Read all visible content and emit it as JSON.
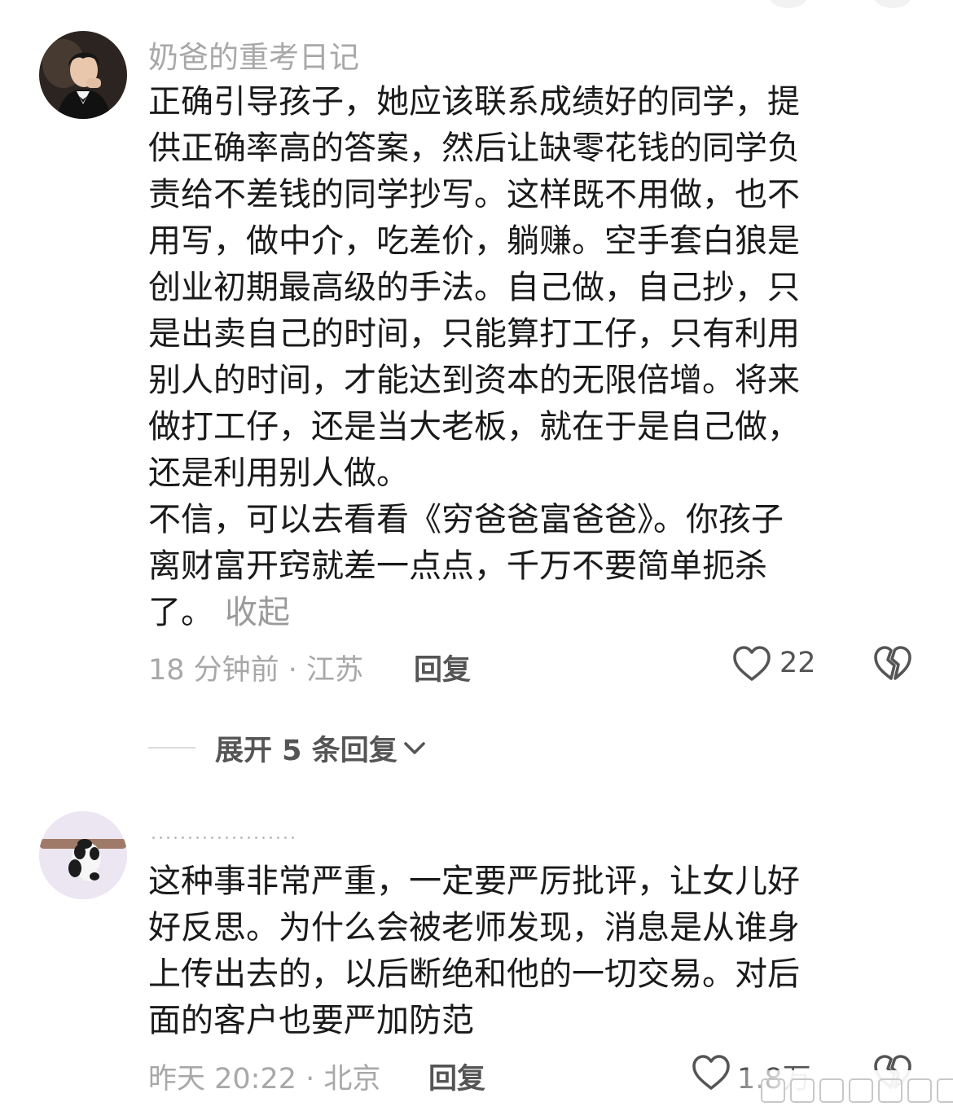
{
  "comments": [
    {
      "username": "奶爸的重考日记",
      "body_lines": [
        "正确引导孩子，她应该联系成绩好的同学，提",
        "供正确率高的答案，然后让缺零花钱的同学负",
        "责给不差钱的同学抄写。这样既不用做，也不",
        "用写，做中介，吃差价，躺赚。空手套白狼是",
        "创业初期最高级的手法。自己做，自己抄，只",
        "是出卖自己的时间，只能算打工仔，只有利用",
        "别人的时间，才能达到资本的无限倍增。将来",
        "做打工仔，还是当大老板，就在于是自己做，",
        "还是利用别人做。",
        "不信，可以去看看《穷爸爸富爸爸》。你孩子",
        "离财富开窍就差一点点，千万不要简单扼杀",
        "了。"
      ],
      "collapse_label": "收起",
      "timestamp": "18 分钟前 · 江苏",
      "reply_label": "回复",
      "like_count": "22",
      "expand_replies_label": "展开 5 条回复"
    },
    {
      "body_lines": [
        "这种事非常严重，一定要严厉批评，让女儿好",
        "好反思。为什么会被老师发现，消息是从谁身",
        "上传出去的，以后断绝和他的一切交易。对后",
        "面的客户也要严加防范"
      ],
      "timestamp": "昨天 20:22 · 北京",
      "reply_label": "回复",
      "like_count": "1.8万"
    }
  ],
  "icons": {
    "like": "heart-outline-icon",
    "dislike": "broken-heart-icon",
    "expand": "chevron-down-icon"
  },
  "colors": {
    "text": "#1a1a1a",
    "muted": "#a8a8a8",
    "action": "#555555"
  }
}
